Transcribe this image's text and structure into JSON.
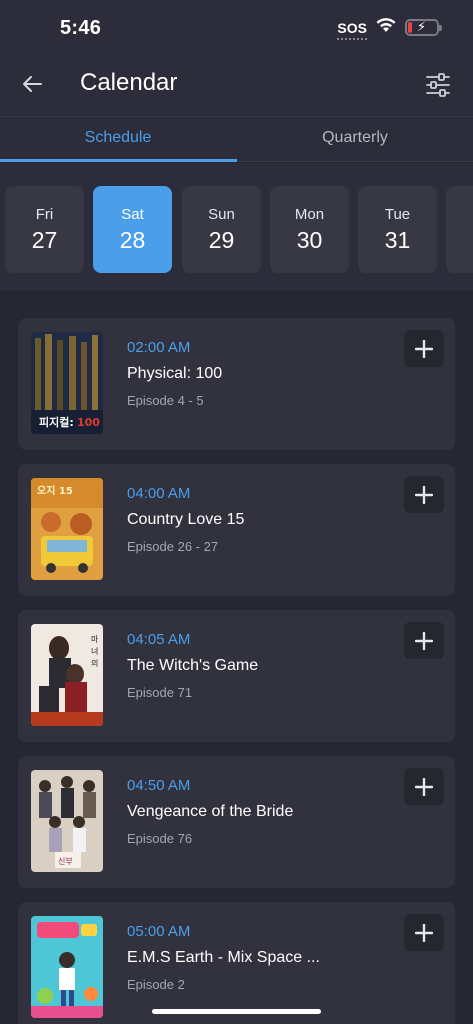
{
  "status": {
    "time": "5:46",
    "carrier": "SOS",
    "battery_level": 0.15
  },
  "header": {
    "title": "Calendar",
    "back_icon": "arrow-left-icon",
    "filter_icon": "sliders-icon"
  },
  "tabs": [
    {
      "label": "Schedule",
      "active": true
    },
    {
      "label": "Quarterly",
      "active": false
    }
  ],
  "dates": [
    {
      "dow": "Fri",
      "day": "27",
      "selected": false
    },
    {
      "dow": "Sat",
      "day": "28",
      "selected": true
    },
    {
      "dow": "Sun",
      "day": "29",
      "selected": false
    },
    {
      "dow": "Mon",
      "day": "30",
      "selected": false
    },
    {
      "dow": "Tue",
      "day": "31",
      "selected": false
    },
    {
      "dow": "W",
      "day": "",
      "selected": false
    }
  ],
  "shows": [
    {
      "time": "02:00 AM",
      "title": "Physical: 100",
      "episode": "Episode 4 - 5"
    },
    {
      "time": "04:00 AM",
      "title": "Country Love 15",
      "episode": "Episode 26 - 27"
    },
    {
      "time": "04:05 AM",
      "title": "The Witch's Game",
      "episode": "Episode 71"
    },
    {
      "time": "04:50 AM",
      "title": "Vengeance of the Bride",
      "episode": "Episode 76"
    },
    {
      "time": "05:00 AM",
      "title": "E.M.S Earth - Mix Space ...",
      "episode": "Episode 2"
    }
  ],
  "colors": {
    "accent": "#4a9eea",
    "background": "#272733",
    "card": "#32323f"
  }
}
